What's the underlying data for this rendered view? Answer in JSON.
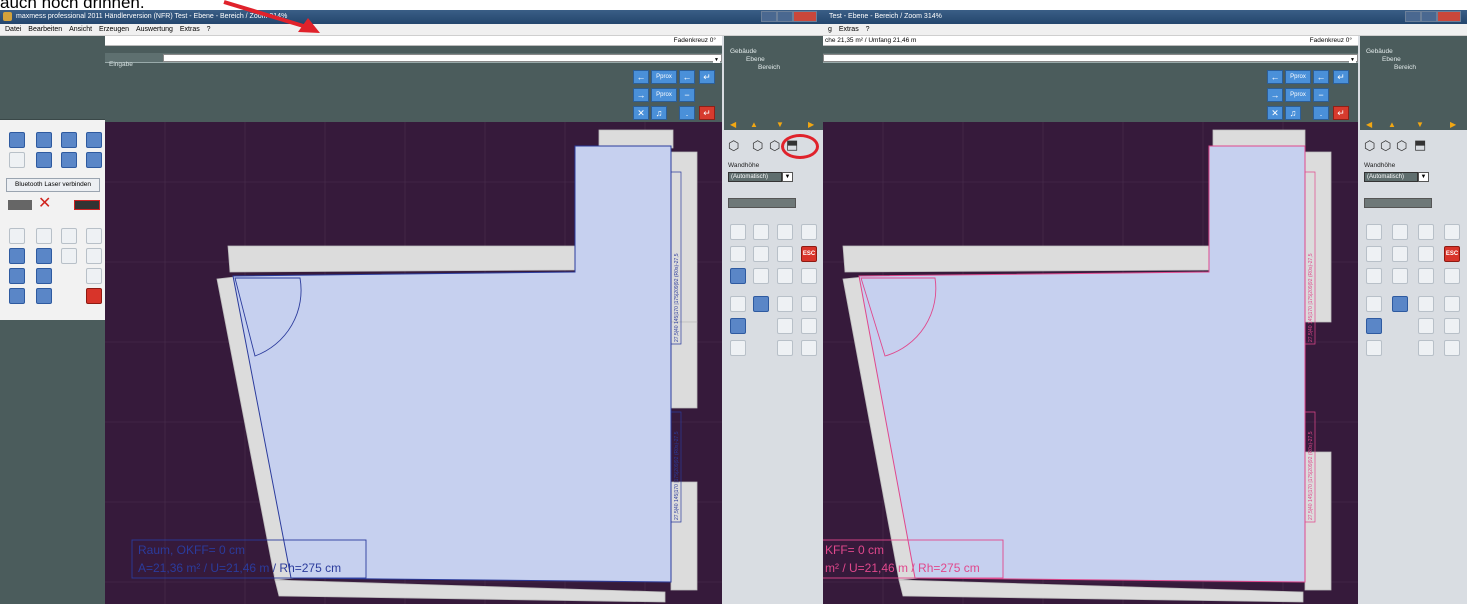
{
  "annotation": {
    "text": "auch noch drinnen."
  },
  "left": {
    "title": "maxmess professional 2011 Händlerversion (NFR)  Test - Ebene - Bereich / Zoom 314%",
    "menu": [
      "Datei",
      "Bearbeiten",
      "Ansicht",
      "Erzeugen",
      "Auswertung",
      "Extras",
      "?"
    ],
    "status_right": "Fadenkreuz 0°",
    "input_label": "Eingabe",
    "bluetooth_button": "Bluetooth Laser verbinden",
    "toolbar": {
      "btn_top": "Pprox",
      "btn_mid": "Pprox"
    },
    "tree": [
      "Gebäude",
      "Ebene",
      "Bereich"
    ],
    "wandhoehe_label": "Wandhöhe",
    "wandhoehe_value": "(Automatisch)",
    "room_label_line1": "Raum, OKFF= 0 cm",
    "room_label_line2": "A=21,36 m² / U=21,46 m / Rh=275 cm",
    "dim_text": "27,5|40 145|170 |175|209|92 (R0s)-27,5"
  },
  "right": {
    "title": "Test - Ebene - Bereich / Zoom 314%",
    "menu": [
      "g",
      "Extras",
      "?"
    ],
    "status_left": "che 21,35 m² / Umfang 21,46 m",
    "status_right": "Fadenkreuz 0°",
    "tree": [
      "Gebäude",
      "Ebene",
      "Bereich"
    ],
    "wandhoehe_label": "Wandhöhe",
    "wandhoehe_value": "(Automatisch)",
    "esc_label": "ESC",
    "room_label_line1": "KFF= 0 cm",
    "room_label_line2": "m² / U=21,46 m / Rh=275 cm"
  },
  "colors": {
    "canvas": "#361a3b",
    "room_fill": "#c6d0ef",
    "room_outline_left": "#2b3b9c",
    "room_outline_right": "#e0488c",
    "wall": "#dcdcdc",
    "highlight_circle": "#e0222b",
    "arrow": "#e0222b"
  }
}
